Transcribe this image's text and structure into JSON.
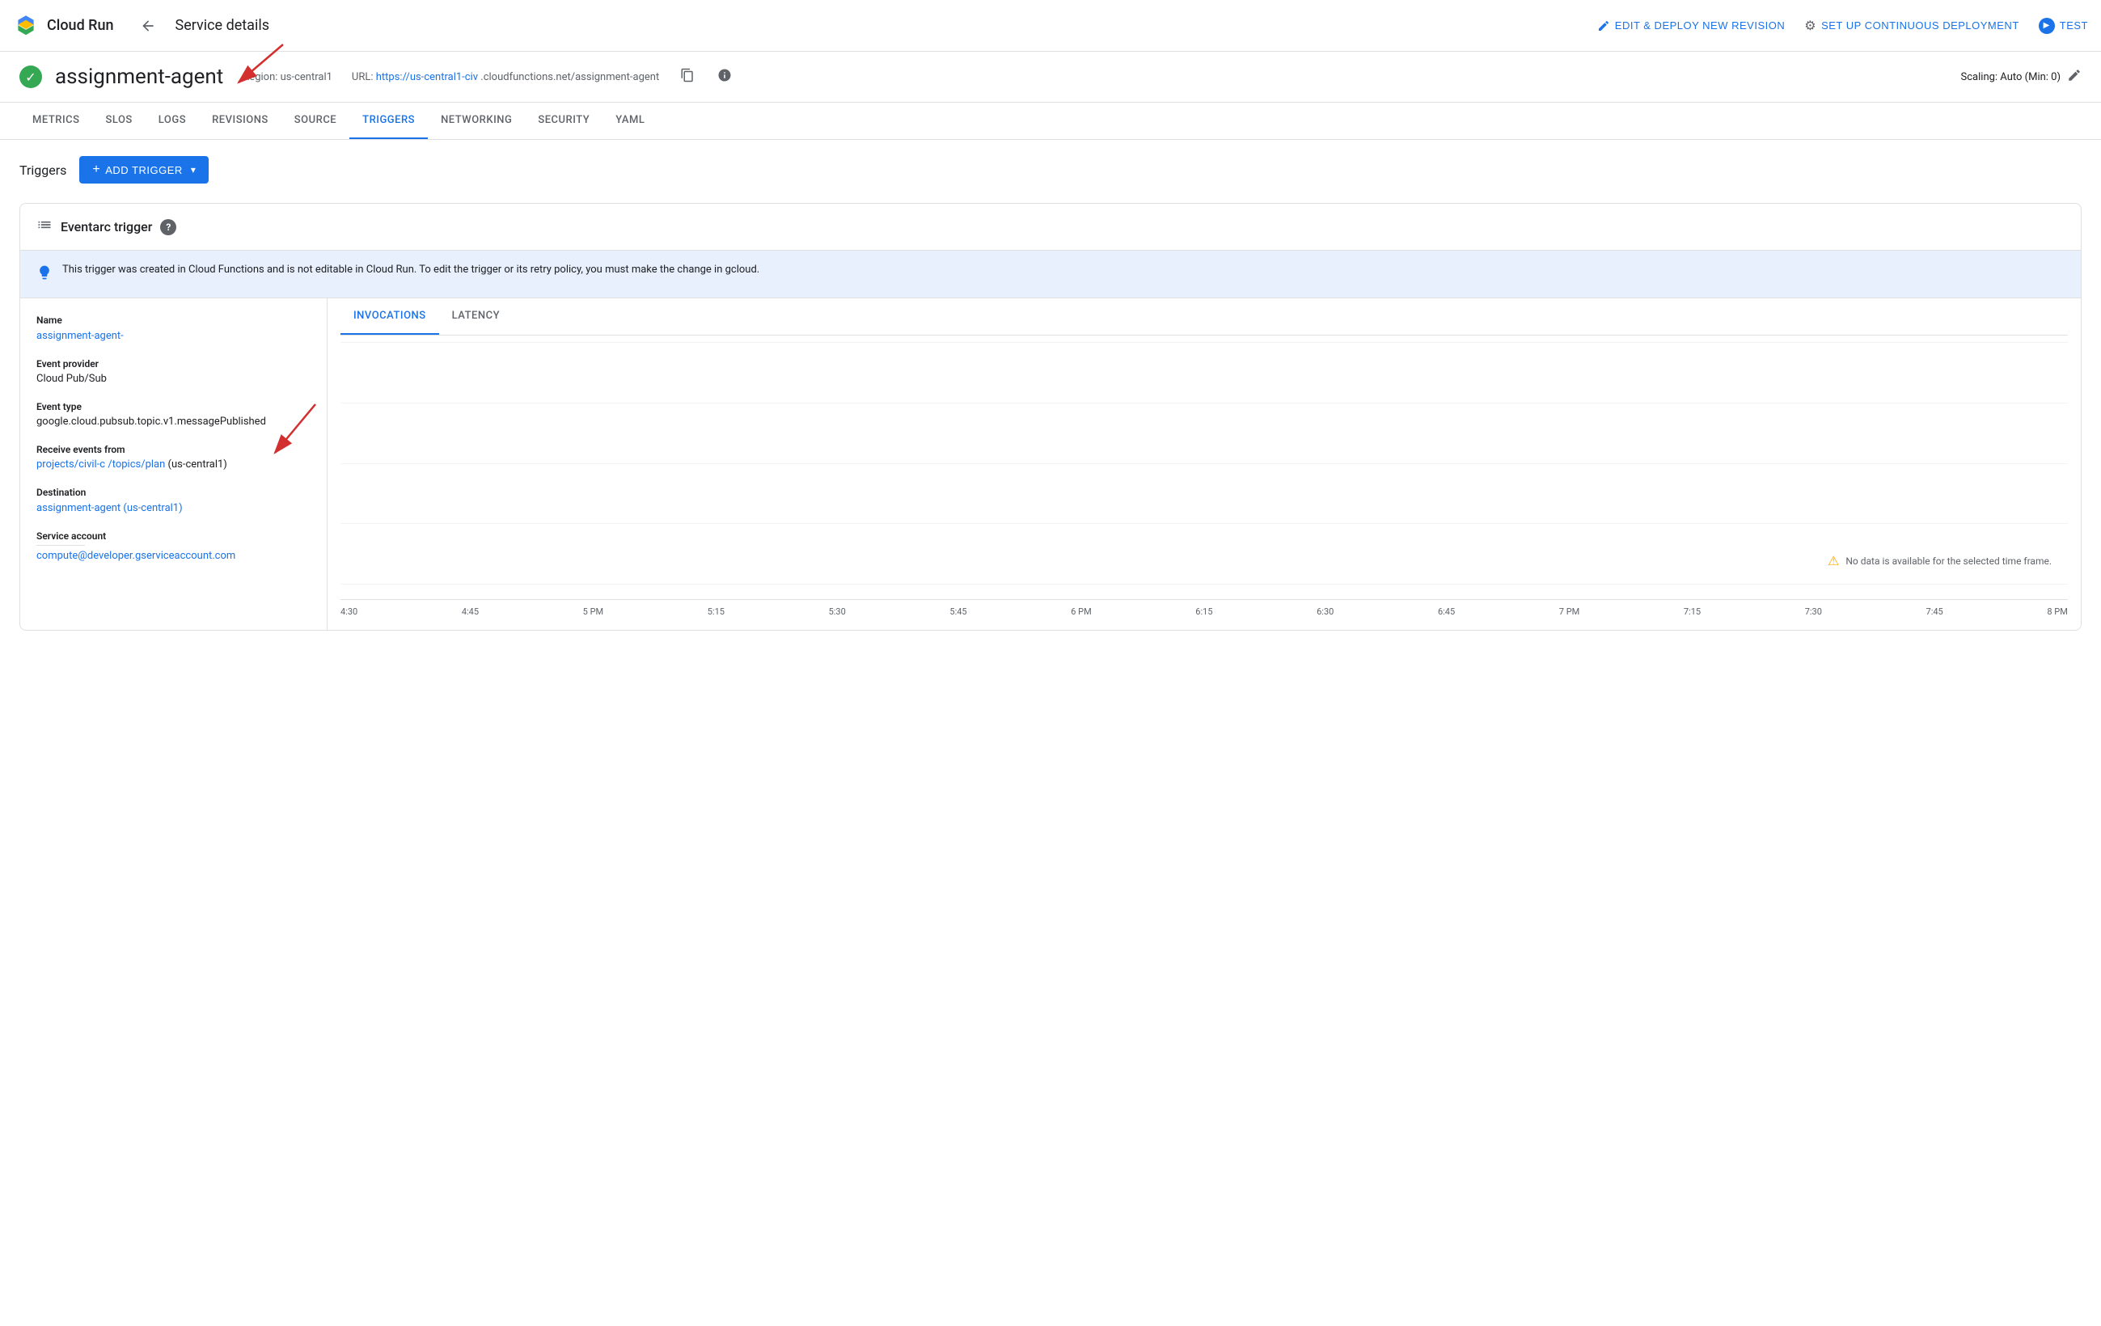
{
  "app": {
    "brand_name": "Cloud Run",
    "page_title": "Service details"
  },
  "top_nav": {
    "edit_deploy_label": "EDIT & DEPLOY NEW REVISION",
    "continuous_deploy_label": "SET UP CONTINUOUS DEPLOYMENT",
    "test_label": "TEST"
  },
  "service_header": {
    "service_name": "assignment-agent",
    "region_label": "Region: us-central1",
    "url_label": "URL:",
    "url_text": "https://us-central1-civ",
    "url_suffix": ".cloudfunctions.net/assignment-agent",
    "scaling_label": "Scaling: Auto (Min: 0)"
  },
  "tabs": [
    {
      "label": "METRICS",
      "active": false
    },
    {
      "label": "SLOS",
      "active": false
    },
    {
      "label": "LOGS",
      "active": false
    },
    {
      "label": "REVISIONS",
      "active": false
    },
    {
      "label": "SOURCE",
      "active": false
    },
    {
      "label": "TRIGGERS",
      "active": true
    },
    {
      "label": "NETWORKING",
      "active": false
    },
    {
      "label": "SECURITY",
      "active": false
    },
    {
      "label": "YAML",
      "active": false
    }
  ],
  "triggers_section": {
    "title": "Triggers",
    "add_trigger_label": "ADD TRIGGER"
  },
  "eventarc_trigger": {
    "title": "Eventarc trigger",
    "info_message": "This trigger was created in Cloud Functions and is not editable in Cloud Run. To edit the trigger or its retry policy, you must make the change in gcloud.",
    "name_label": "Name",
    "name_value": "assignment-agent-",
    "event_provider_label": "Event provider",
    "event_provider_value": "Cloud Pub/Sub",
    "event_type_label": "Event type",
    "event_type_value": "google.cloud.pubsub.topic.v1.messagePublished",
    "receive_events_label": "Receive events from",
    "receive_events_value": "projects/civil-c",
    "receive_events_suffix": "/topics/plan",
    "receive_events_region": "(us-central1)",
    "destination_label": "Destination",
    "destination_value": "assignment-agent (us-central1)",
    "service_account_label": "Service account",
    "service_account_value": "compute@developer.gserviceaccount.com"
  },
  "chart": {
    "tab_invocations": "INVOCATIONS",
    "tab_latency": "LATENCY",
    "no_data_message": "No data is available for the selected time frame.",
    "x_axis_labels": [
      "4:30",
      "4:45",
      "5 PM",
      "5:15",
      "5:30",
      "5:45",
      "6 PM",
      "6:15",
      "6:30",
      "6:45",
      "7 PM",
      "7:15",
      "7:30",
      "7:45",
      "8 PM"
    ]
  }
}
